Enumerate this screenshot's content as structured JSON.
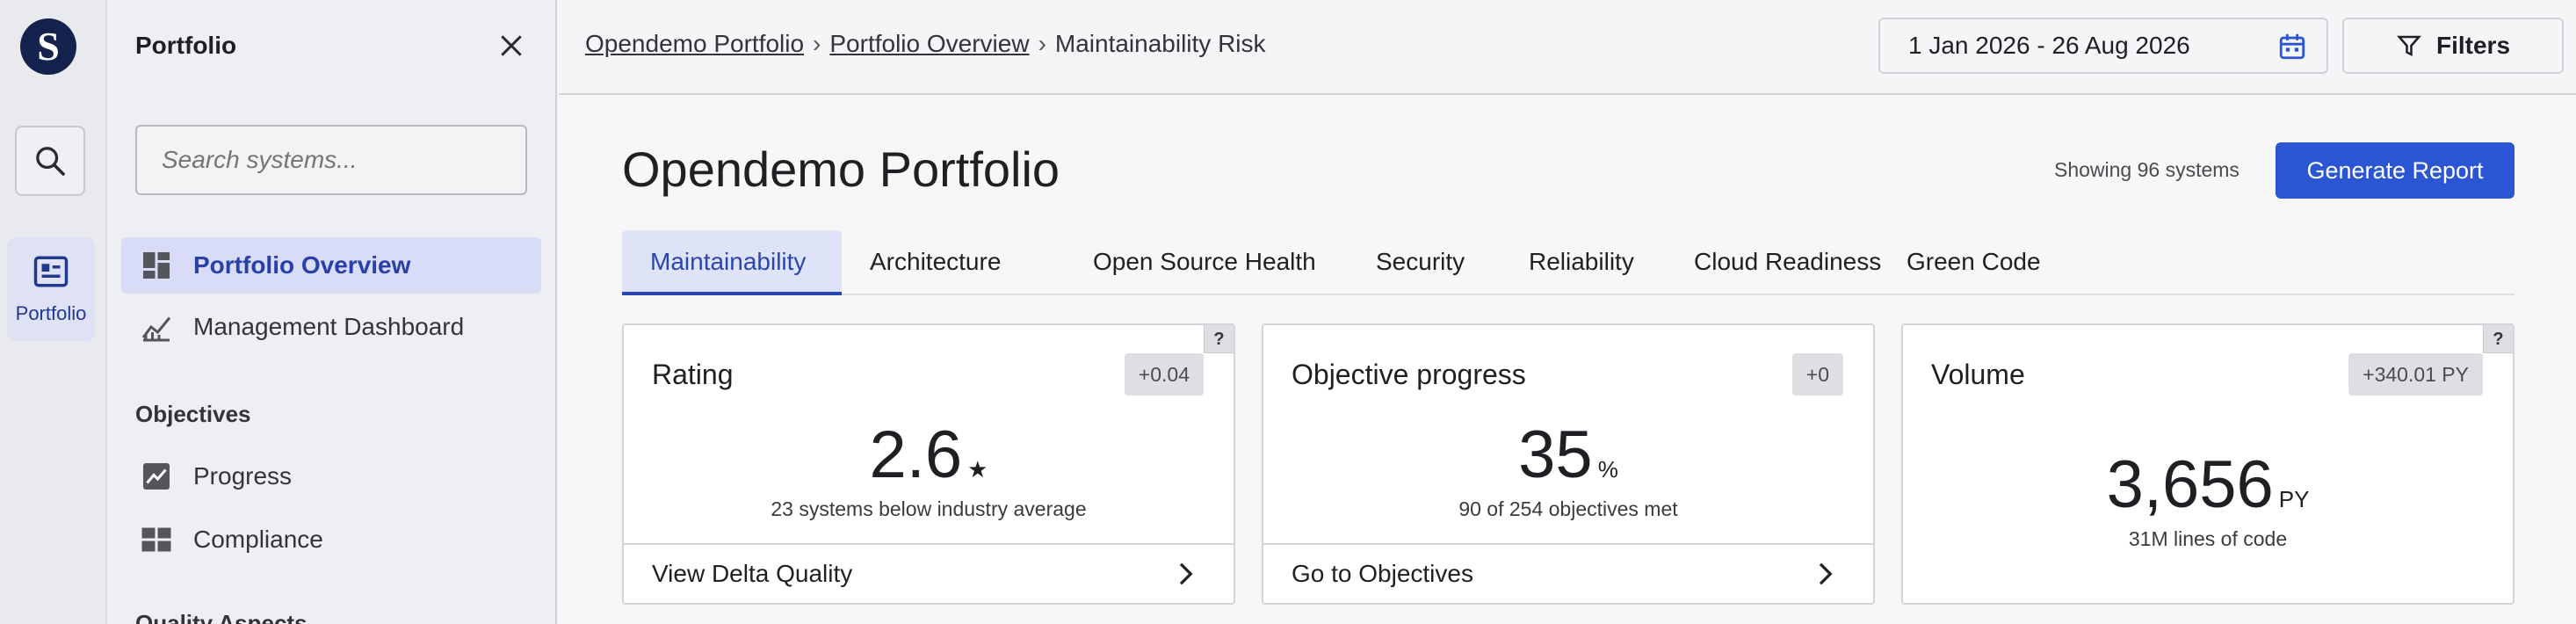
{
  "rail": {
    "logo_letter": "S",
    "portfolio_label": "Portfolio"
  },
  "sidebar": {
    "title": "Portfolio",
    "search_placeholder": "Search systems...",
    "items": [
      {
        "label": "Portfolio Overview",
        "icon": "dashboard-icon",
        "active": true
      },
      {
        "label": "Management Dashboard",
        "icon": "chart-line-icon",
        "active": false
      }
    ],
    "objectives_heading": "Objectives",
    "objective_items": [
      {
        "label": "Progress",
        "icon": "trend-icon"
      },
      {
        "label": "Compliance",
        "icon": "grid-icon"
      }
    ],
    "quality_heading": "Quality Aspects"
  },
  "breadcrumb": {
    "items": [
      "Opendemo Portfolio",
      "Portfolio Overview"
    ],
    "current": "Maintainability Risk"
  },
  "date_range": "1 Jan 2026 - 26 Aug 2026",
  "filters_label": "Filters",
  "page": {
    "title": "Opendemo Portfolio",
    "showing": "Showing 96 systems",
    "generate_label": "Generate Report"
  },
  "tabs": [
    {
      "label": "Maintainability",
      "active": true
    },
    {
      "label": "Architecture"
    },
    {
      "label": "Open Source Health"
    },
    {
      "label": "Security"
    },
    {
      "label": "Reliability"
    },
    {
      "label": "Cloud Readiness"
    },
    {
      "label": "Green Code"
    }
  ],
  "cards": [
    {
      "title": "Rating",
      "badge": "+0.04",
      "value": "2.6",
      "unit": "★",
      "sub": "23 systems below industry average",
      "footer": "View Delta Quality",
      "help": "?"
    },
    {
      "title": "Objective progress",
      "badge": "+0",
      "value": "35",
      "unit": "%",
      "sub": "90 of 254 objectives met",
      "footer": "Go to Objectives"
    },
    {
      "title": "Volume",
      "badge": "+340.01 PY",
      "value": "3,656",
      "unit": "PY",
      "sub": "31M lines of code",
      "help": "?"
    }
  ],
  "colors": {
    "accent": "#2a56d3",
    "active_tab": "#2a45b0",
    "active_nav_bg": "#d8dcf6",
    "logo_bg": "#15224e"
  }
}
